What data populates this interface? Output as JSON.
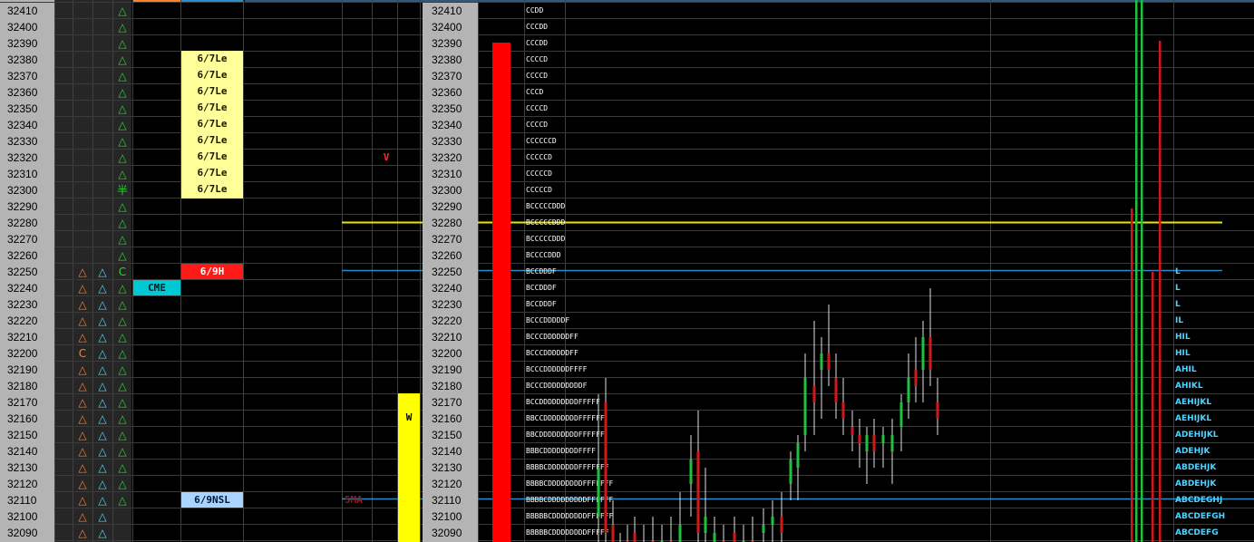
{
  "prices": [
    "32410",
    "32400",
    "32390",
    "32380",
    "32370",
    "32360",
    "32350",
    "32340",
    "32330",
    "32320",
    "32310",
    "32300",
    "32290",
    "32280",
    "32270",
    "32260",
    "32250",
    "32240",
    "32230",
    "32220",
    "32210",
    "32200",
    "32190",
    "32180",
    "32170",
    "32160",
    "32150",
    "32140",
    "32130",
    "32120",
    "32110",
    "32100",
    "32090"
  ],
  "col_orange": [
    "",
    "",
    "",
    "",
    "",
    "",
    "",
    "",
    "",
    "",
    "",
    "",
    "",
    "",
    "",
    "",
    "△",
    "△",
    "△",
    "△",
    "△",
    "C",
    "△",
    "△",
    "△",
    "△",
    "△",
    "△",
    "△",
    "△",
    "△",
    "△",
    "△"
  ],
  "col_blue": [
    "",
    "",
    "",
    "",
    "",
    "",
    "",
    "",
    "",
    "",
    "",
    "",
    "",
    "",
    "",
    "",
    "△",
    "△",
    "△",
    "△",
    "△",
    "△",
    "△",
    "△",
    "△",
    "△",
    "△",
    "△",
    "△",
    "△",
    "△",
    "△",
    "△"
  ],
  "col_green": [
    "△",
    "△",
    "△",
    "△",
    "△",
    "△",
    "△",
    "△",
    "△",
    "△",
    "△",
    "半",
    "△",
    "△",
    "△",
    "△",
    "C",
    "△",
    "△",
    "△",
    "△",
    "△",
    "△",
    "△",
    "△",
    "△",
    "△",
    "△",
    "△",
    "△",
    "△",
    "",
    ""
  ],
  "tags": {
    "le": "6/7Le",
    "high": "6/9H",
    "cme": "CME",
    "nsl": "6/9NSL",
    "v": "V",
    "w": "W",
    "sma": "5MA"
  },
  "tpo_left": [
    "CCDD",
    "CCCDD",
    "CCCDD",
    "CCCCD",
    "CCCCD",
    "CCCD",
    "CCCCD",
    "CCCCD",
    "CCCCCCD",
    "CCCCCD",
    "CCCCCD",
    "CCCCCD",
    "BCCCCCDDD",
    "BCCCCCDDD",
    "BCCCCCDDD",
    "BCCCCDDD",
    "BCCDDDF",
    "BCCDDDF",
    "BCCDDDF",
    "BCCCDDDDDF",
    "BCCCDDDDDDFF",
    "BCCCDDDDDDFF",
    "BCCCDDDDDDFFFF",
    "BCCCDDDDDDDDDF",
    "BCCDDDDDDDDDFFFFF",
    "BBCCDDDDDDDDFFFFFF",
    "BBCDDDDDDDDDFFFFFF",
    "BBBCDDDDDDDDFFFF",
    "BBBBCDDDDDDDFFFFFFF",
    "BBBBCDDDDDDDDFFFFFFF",
    "BBBBCDDDDDDDDDFFFFFF",
    "BBBBBCDDDDDDDDFFFFFF",
    "BBBBBCDDDDDDDDFFFFF"
  ],
  "tpo_right": [
    "",
    "",
    "",
    "",
    "",
    "",
    "",
    "",
    "",
    "",
    "",
    "",
    "",
    "",
    "",
    "",
    "L",
    "L",
    "L",
    "IL",
    "HIL",
    "HIL",
    "AHIL",
    "AHIKL",
    "AEHIJKL",
    "AEHIJKL",
    "ADEHIJKL",
    "ADEHJK",
    "ABDEHJK",
    "ABDEHJK",
    "ABCDEGHJ",
    "ABCDEFGH",
    "ABCDEFG"
  ],
  "colors": {
    "price_bg": "#b4b4b4",
    "tag_yellow": "#ffff99",
    "tag_red": "#ff1a1a",
    "tag_cyan": "#00c8d2",
    "tag_lightblue": "#a8d4ff",
    "line_yellow": "#e6e600",
    "line_blue": "#2a8cc8",
    "bar_red": "#ff0000",
    "bar_yellow": "#ffff00"
  }
}
